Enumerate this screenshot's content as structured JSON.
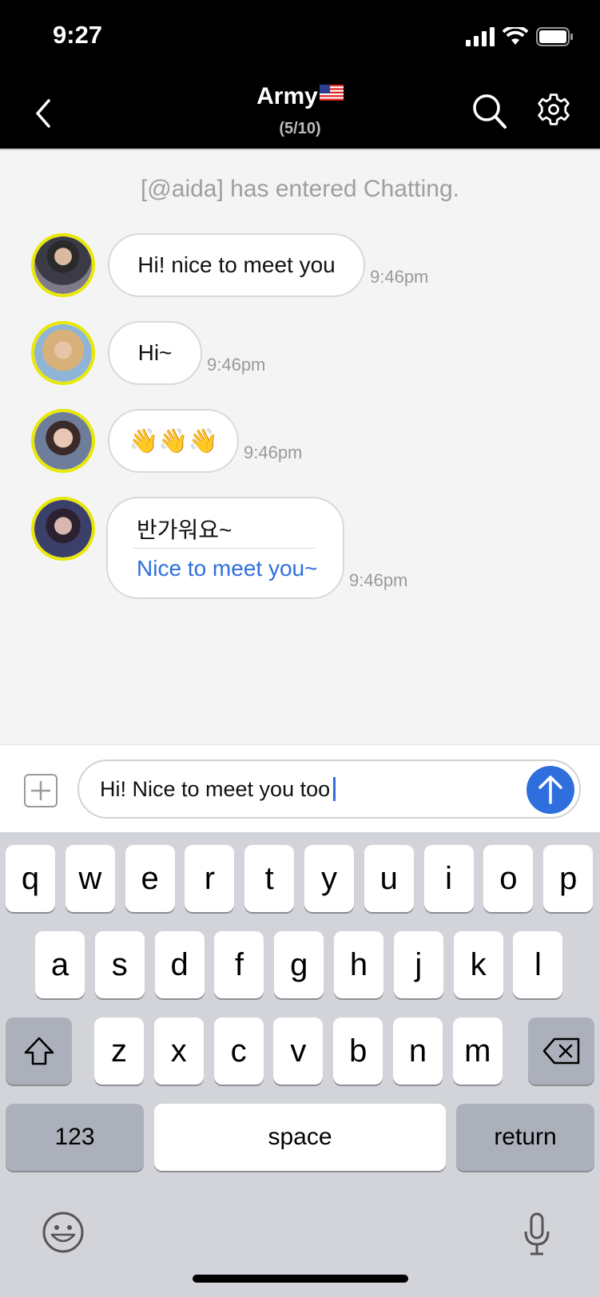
{
  "status_bar": {
    "time": "9:27"
  },
  "header": {
    "title": "Army",
    "flag": "us-flag",
    "subtitle": "(5/10)"
  },
  "chat": {
    "system_message": "[@aida] has entered Chatting.",
    "messages": [
      {
        "avatar": "avatar-user-1",
        "text": "Hi! nice to meet you",
        "time": "9:46pm"
      },
      {
        "avatar": "avatar-user-2",
        "text": "Hi~",
        "time": "9:46pm"
      },
      {
        "avatar": "avatar-user-3",
        "text": "👋👋👋",
        "time": "9:46pm"
      },
      {
        "avatar": "avatar-user-4",
        "original": "반가워요~",
        "translation": "Nice to meet you~",
        "time": "9:46pm"
      }
    ]
  },
  "input": {
    "value": "Hi! Nice to meet you too"
  },
  "keyboard": {
    "row1": [
      "q",
      "w",
      "e",
      "r",
      "t",
      "y",
      "u",
      "i",
      "o",
      "p"
    ],
    "row2": [
      "a",
      "s",
      "d",
      "f",
      "g",
      "h",
      "j",
      "k",
      "l"
    ],
    "row3": [
      "z",
      "x",
      "c",
      "v",
      "b",
      "n",
      "m"
    ],
    "numbers_label": "123",
    "space_label": "space",
    "return_label": "return"
  },
  "colors": {
    "accent": "#2f6fdd",
    "avatar_ring": "#e8e800",
    "header_bg": "#000000"
  }
}
